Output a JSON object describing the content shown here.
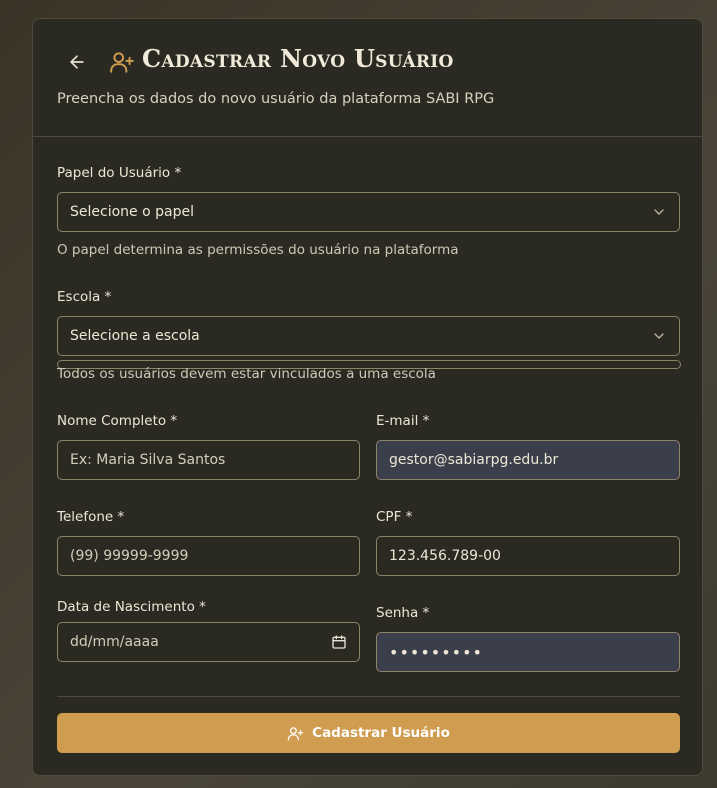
{
  "header": {
    "title": "Cadastrar Novo Usuário",
    "subtitle": "Preencha os dados do novo usuário da plataforma SABI RPG"
  },
  "fields": {
    "papel": {
      "label": "Papel do Usuário *",
      "value": "Selecione o papel",
      "hint": "O papel determina as permissões do usuário na plataforma"
    },
    "escola": {
      "label": "Escola *",
      "value": "Selecione a escola",
      "hint": "Todos os usuários devem estar vinculados a uma escola"
    },
    "nome": {
      "label": "Nome Completo *",
      "placeholder": "Ex: Maria Silva Santos"
    },
    "email": {
      "label": "E-mail *",
      "value": "gestor@sabiarpg.edu.br"
    },
    "telefone": {
      "label": "Telefone *",
      "placeholder": "(99) 99999-9999"
    },
    "cpf": {
      "label": "CPF *",
      "value": "123.456.789-00"
    },
    "nascimento": {
      "label": "Data de Nascimento *",
      "placeholder": "dd/mm/aaaa"
    },
    "senha": {
      "label": "Senha *",
      "value": "•••••••••"
    }
  },
  "submit": {
    "label": "Cadastrar Usuário"
  },
  "colors": {
    "accent": "#d09c4f",
    "card": "#2b2a22",
    "filled_input": "#3a3f4b"
  }
}
